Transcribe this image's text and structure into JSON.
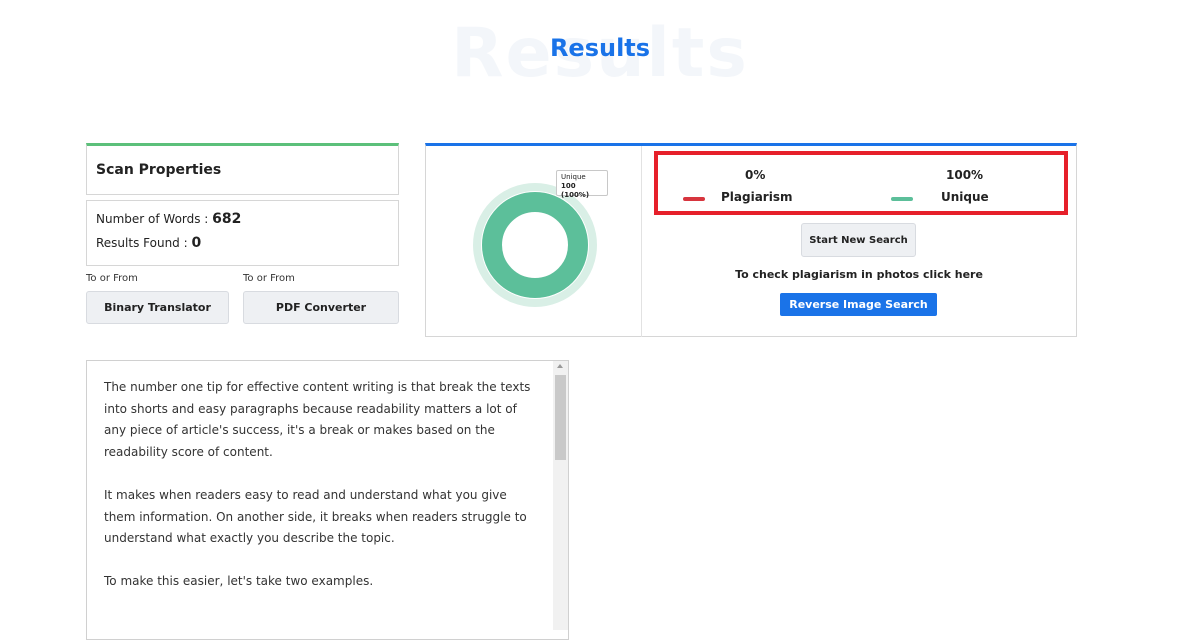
{
  "page": {
    "title_ghost": "Results",
    "title": "Results"
  },
  "scan": {
    "header": "Scan Properties",
    "words_label": "Number of Words : ",
    "words_value": "682",
    "results_label": "Results Found : ",
    "results_value": "0"
  },
  "tools": [
    {
      "caption": "To or From",
      "label": "Binary Translator"
    },
    {
      "caption": "To or From",
      "label": "PDF Converter"
    }
  ],
  "results": {
    "tooltip_line1": "Unique",
    "tooltip_line2": "100 (100%)",
    "plagiarism_pct": "0%",
    "plagiarism_label": "Plagiarism",
    "unique_pct": "100%",
    "unique_label": "Unique",
    "unique_fraction": 1.0,
    "new_search": "Start New Search",
    "check_text": "To check plagiarism in photos click here",
    "reverse_search": "Reverse Image Search"
  },
  "colors": {
    "accent": "#1a73e8",
    "unique": "#5cbf9a",
    "plagiarism": "#e6202a",
    "highlight_border": "#e6202a"
  },
  "content": {
    "paragraphs": [
      "The number one tip for effective content writing is that break the texts into shorts and easy paragraphs because readability matters a lot of any piece of article's success, it's a break or makes based on the readability score of content.",
      "It makes when readers easy to read and understand what you give them information. On another side, it breaks when readers struggle to understand what exactly you describe the topic.",
      "To make this easier, let's take two examples."
    ]
  }
}
